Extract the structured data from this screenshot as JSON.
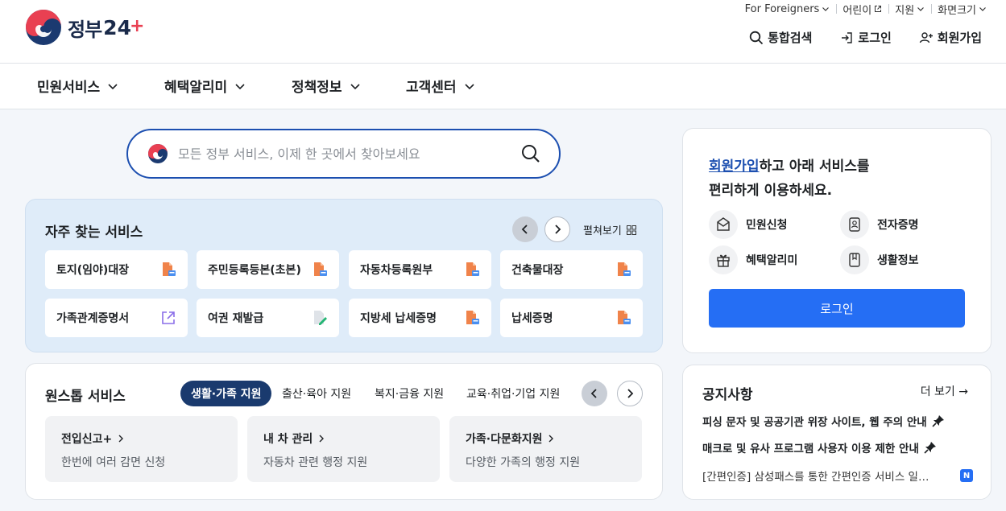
{
  "header": {
    "logo_text": "정부",
    "logo_num": "24",
    "logo_plus": "+",
    "util": [
      "For Foreigners",
      "어린이",
      "지원",
      "화면크기"
    ],
    "actions": {
      "search": "통합검색",
      "login": "로그인",
      "signup": "회원가입"
    }
  },
  "nav": {
    "items": [
      "민원서비스",
      "혜택알리미",
      "정책정보",
      "고객센터"
    ]
  },
  "search": {
    "placeholder": "모든 정부 서비스, 이제 한 곳에서 찾아보세요"
  },
  "frequent": {
    "title": "자주 찾는 서비스",
    "unfold": "펼쳐보기",
    "tiles": [
      "토지(임야)대장",
      "주민등록등본(초본)",
      "자동차등록원부",
      "건축물대장",
      "가족관계증명서",
      "여권 재발급",
      "지방세 납세증명",
      "납세증명"
    ]
  },
  "onestop": {
    "title": "원스톱 서비스",
    "tabs": [
      "생활·가족 지원",
      "출산·육아 지원",
      "복지·금융 지원",
      "교육·취업·기업 지원"
    ],
    "cards": [
      {
        "title": "전입신고+",
        "desc": "한번에 여러 감면 신청"
      },
      {
        "title": "내 차 관리",
        "desc": "자동차 관련 행정 지원"
      },
      {
        "title": "가족·다문화지원",
        "desc": "다양한 가족의 행정 지원"
      }
    ]
  },
  "login_panel": {
    "link": "회원가입",
    "msg1": "하고 아래 서비스를",
    "msg2": "편리하게 이용하세요.",
    "services": [
      "민원신청",
      "전자증명",
      "혜택알리미",
      "생활정보"
    ],
    "button": "로그인"
  },
  "notice": {
    "title": "공지사항",
    "more": "더 보기",
    "items": [
      "피싱 문자 및 공공기관 위장 사이트, 웹 주의 안내",
      "매크로 및 유사 프로그램 사용자 이용 제한 안내",
      "[간편인증] 삼성패스를 통한 간편인증 서비스 일…"
    ],
    "badge": "N"
  },
  "colors": {
    "primary": "#256ef4",
    "navy": "#1a3a6e",
    "search_border": "#1c4fb0",
    "freq_bg": "#dfecf9"
  }
}
